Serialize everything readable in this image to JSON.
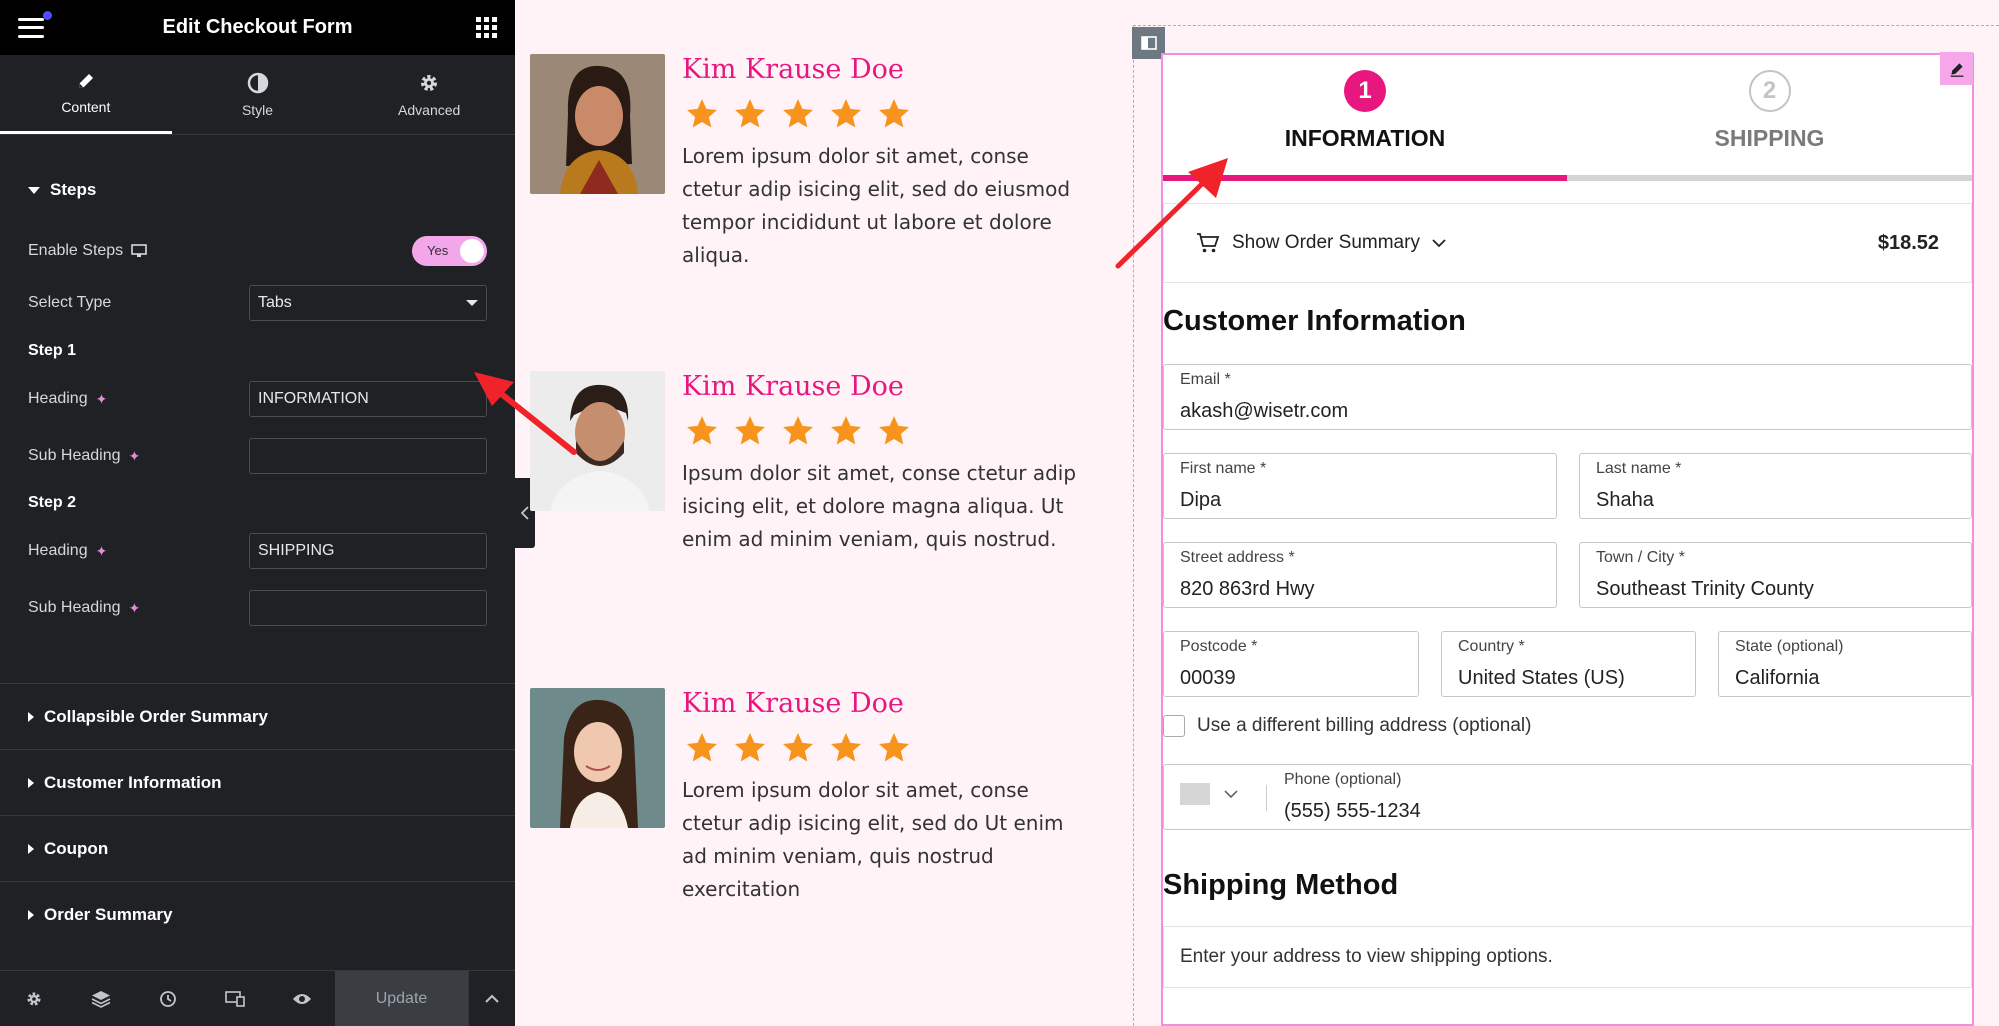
{
  "sidebar": {
    "title": "Edit Checkout Form",
    "tabs": [
      {
        "label": "Content",
        "icon": "pencil-icon"
      },
      {
        "label": "Style",
        "icon": "contrast-icon"
      },
      {
        "label": "Advanced",
        "icon": "gear-icon"
      }
    ],
    "steps_section": {
      "title": "Steps",
      "enable_steps_label": "Enable Steps",
      "enable_steps_value": "Yes",
      "select_type_label": "Select Type",
      "select_type_value": "Tabs",
      "step1_label": "Step 1",
      "step1_heading_label": "Heading",
      "step1_heading_value": "INFORMATION",
      "step1_subheading_label": "Sub Heading",
      "step1_subheading_value": "",
      "step2_label": "Step 2",
      "step2_heading_label": "Heading",
      "step2_heading_value": "SHIPPING",
      "step2_subheading_label": "Sub Heading",
      "step2_subheading_value": ""
    },
    "accordions": [
      "Collapsible Order Summary",
      "Customer Information",
      "Coupon",
      "Order Summary"
    ],
    "footer": {
      "update_label": "Update"
    }
  },
  "testimonials": [
    {
      "name": "Kim Krause Doe",
      "rating": 5,
      "text": "Lorem ipsum dolor sit amet, conse ctetur adip isicing elit, sed do eiusmod tempor incididunt ut labore et dolore aliqua."
    },
    {
      "name": "Kim Krause Doe",
      "rating": 5,
      "text": "Ipsum dolor sit amet, conse ctetur adip isicing elit, et dolore magna aliqua. Ut enim ad minim veniam, quis nostrud."
    },
    {
      "name": "Kim Krause Doe",
      "rating": 5,
      "text": "Lorem ipsum dolor sit amet, conse ctetur adip isicing elit, sed do Ut enim ad minim veniam, quis nostrud exercitation"
    }
  ],
  "checkout": {
    "steps": [
      {
        "number": "1",
        "title": "INFORMATION",
        "active": true
      },
      {
        "number": "2",
        "title": "SHIPPING",
        "active": false
      }
    ],
    "order_summary": {
      "label": "Show Order Summary",
      "total": "$18.52"
    },
    "customer_heading": "Customer Information",
    "fields": {
      "email": {
        "label": "Email *",
        "value": "akash@wisetr.com"
      },
      "first_name": {
        "label": "First name *",
        "value": "Dipa"
      },
      "last_name": {
        "label": "Last name *",
        "value": "Shaha"
      },
      "street": {
        "label": "Street address *",
        "value": "820 863rd Hwy"
      },
      "town": {
        "label": "Town / City *",
        "value": "Southeast Trinity County"
      },
      "postcode": {
        "label": "Postcode *",
        "value": "00039"
      },
      "country": {
        "label": "Country *",
        "value": "United States (US)"
      },
      "state": {
        "label": "State (optional)",
        "value": "California"
      },
      "phone": {
        "label": "Phone (optional)",
        "value": "(555) 555-1234"
      }
    },
    "billing_checkbox_label": "Use a different billing address (optional)",
    "shipping_heading": "Shipping Method",
    "shipping_message": "Enter your address to view shipping options."
  },
  "colors": {
    "accent_pink": "#e8177f",
    "star_orange": "#f7941d",
    "sidebar_bg": "#1f2124",
    "toggle_pink": "#f2a7ea",
    "arrow_red": "#f0232a"
  }
}
